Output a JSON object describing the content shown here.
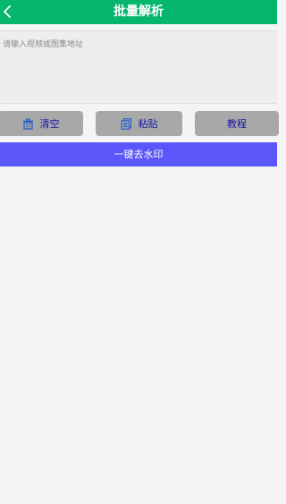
{
  "header": {
    "title": "批量解析",
    "back_icon": "back-arrow-icon"
  },
  "input": {
    "placeholder": "请输入视频或图集地址",
    "value": ""
  },
  "toolbar": {
    "clear_label": "清空",
    "clear_icon": "trash-icon",
    "paste_label": "粘贴",
    "paste_icon": "clipboard-icon",
    "tutorial_label": "教程"
  },
  "primary_action": {
    "label": "一键去水印"
  },
  "colors": {
    "header_bg": "#06b66c",
    "button_bg": "#a8a8a8",
    "button_text": "#1414a8",
    "primary_bg": "#5a56fa",
    "page_bg": "#f4f4f4"
  }
}
